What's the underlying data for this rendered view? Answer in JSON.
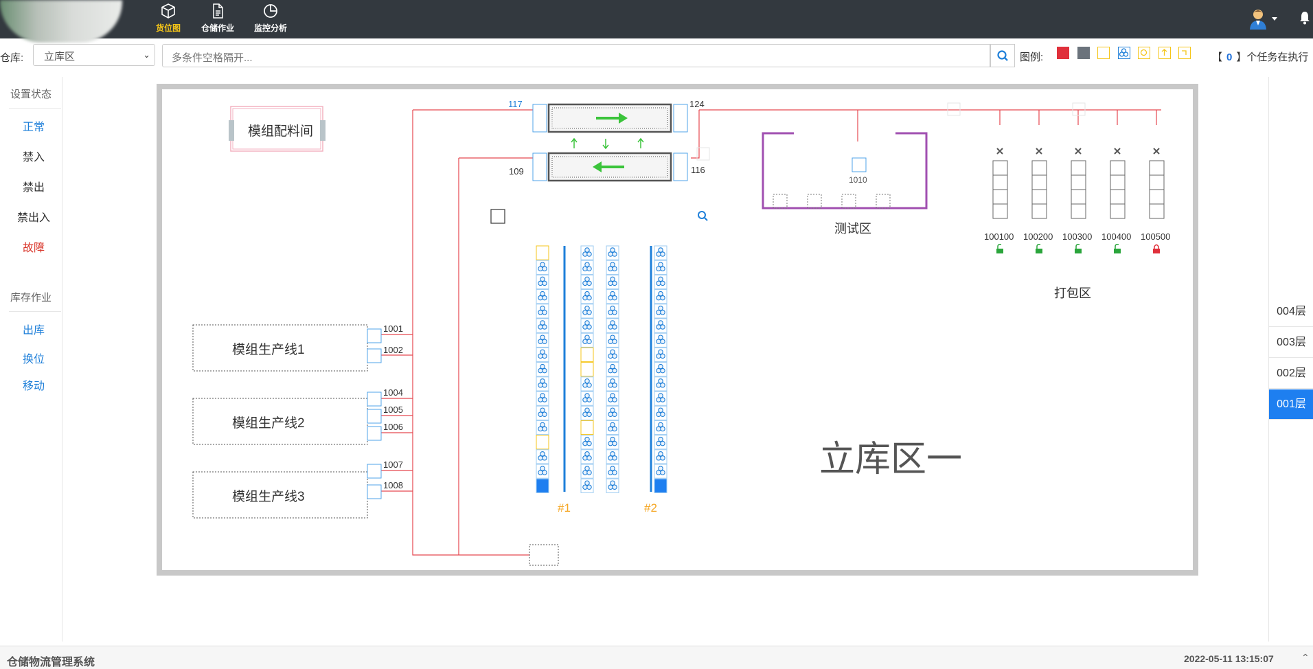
{
  "top_nav": [
    {
      "label": "货位图",
      "icon": "box-icon",
      "active": true
    },
    {
      "label": "仓储作业",
      "icon": "document-icon",
      "active": false
    },
    {
      "label": "监控分析",
      "icon": "pie-chart-icon",
      "active": false
    }
  ],
  "toolbar": {
    "warehouse_label": "仓库:",
    "warehouse_value": "立库区",
    "search_placeholder": "多条件空格隔开...",
    "legend_label": "图例:",
    "legend_colors": [
      "#e0303b",
      "#6b737c",
      "#f5c518",
      "#1e7fd9",
      "#f5c518",
      "#f5c518",
      "#f5c518"
    ],
    "task_prefix": "【",
    "task_count": "0",
    "task_suffix": "】个任务在执行"
  },
  "sidebar": {
    "status_header": "设置状态",
    "status_items": [
      "正常",
      "禁入",
      "禁出",
      "禁出入",
      "故障"
    ],
    "ops_header": "库存作业",
    "ops_items": [
      "出库",
      "换位",
      "移动"
    ]
  },
  "floors": [
    "004层",
    "003层",
    "002层",
    "001层"
  ],
  "map": {
    "prep_room": "模组配料间",
    "lines": [
      "模组生产线1",
      "模组生产线2",
      "模组生产线3"
    ],
    "port_ids": [
      "1001",
      "1002",
      "1004",
      "1005",
      "1006",
      "1007",
      "1008"
    ],
    "conveyor_ids": [
      "117",
      "124",
      "109",
      "116"
    ],
    "test_zone": "测试区",
    "test_port": "1010",
    "pack_zone": "打包区",
    "pack_ids": [
      "100100",
      "100200",
      "100300",
      "100400",
      "100500"
    ],
    "aisles": [
      "#1",
      "#2"
    ],
    "zone_title": "立库区一"
  },
  "status": {
    "system_name": "仓储物流管理系统",
    "datetime": "2022-05-11 13:15:07"
  }
}
